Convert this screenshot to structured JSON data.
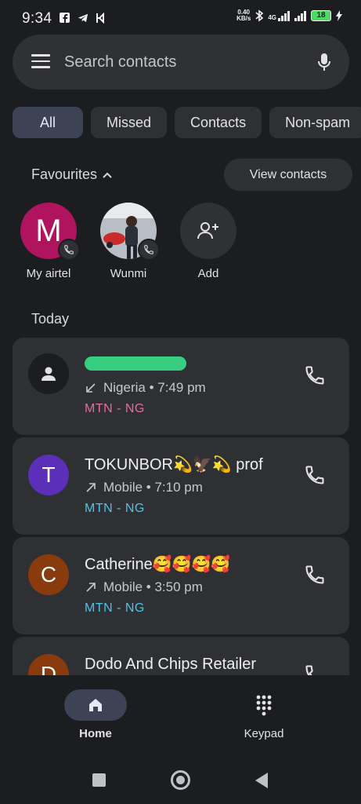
{
  "status_bar": {
    "time": "9:34",
    "speed_value": "0.40",
    "speed_unit": "KB/s",
    "network": "4G",
    "battery": "18"
  },
  "search": {
    "placeholder": "Search contacts"
  },
  "chips": [
    {
      "label": "All",
      "active": true
    },
    {
      "label": "Missed",
      "active": false
    },
    {
      "label": "Contacts",
      "active": false
    },
    {
      "label": "Non-spam",
      "active": false
    }
  ],
  "favourites": {
    "header": "Favourites",
    "view_contacts": "View contacts",
    "items": [
      {
        "name": "My airtel",
        "initial": "M",
        "color": "#b0145e"
      },
      {
        "name": "Wunmi",
        "initial": "",
        "color": "#8a8f99"
      },
      {
        "name": "Add",
        "initial": "",
        "color": "#303134"
      }
    ]
  },
  "section_today": "Today",
  "calls": [
    {
      "title": "",
      "direction": "incoming",
      "meta": "Nigeria • 7:49 pm",
      "sim": "MTN - NG",
      "sim_color": "#e86aa6",
      "initial": "",
      "avatar_color": "#1c1d21"
    },
    {
      "title": "TOKUNBOR💫🦅💫 prof",
      "direction": "outgoing",
      "meta": "Mobile • 7:10 pm",
      "sim": "MTN - NG",
      "sim_color": "#4fc3e8",
      "initial": "T",
      "avatar_color": "#5c2fb8"
    },
    {
      "title": "Catherine🥰🥰🥰🥰",
      "direction": "outgoing",
      "meta": "Mobile • 3:50 pm",
      "sim": "MTN - NG",
      "sim_color": "#4fc3e8",
      "initial": "C",
      "avatar_color": "#8a3b0e"
    },
    {
      "title": "Dodo And Chips Retailer",
      "direction": "",
      "meta": "",
      "sim": "",
      "sim_color": "#4fc3e8",
      "initial": "D",
      "avatar_color": "#8a3b0e"
    }
  ],
  "bottom_nav": {
    "home": "Home",
    "keypad": "Keypad"
  },
  "colors": {
    "background": "#1c1d21",
    "surface": "#2f3034",
    "accent_pill": "#3d4254"
  }
}
